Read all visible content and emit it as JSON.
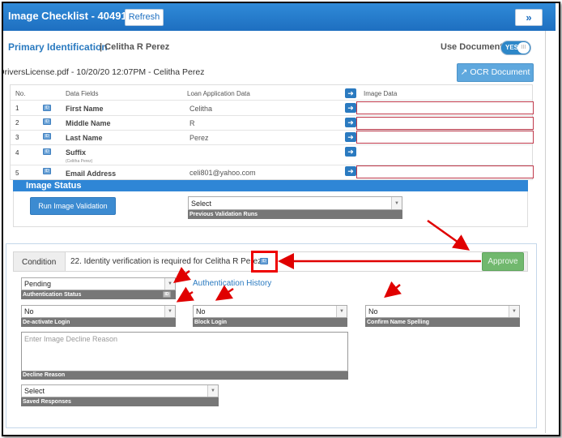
{
  "header": {
    "title": "Image Checklist - 404917",
    "refresh_label": "Refresh",
    "expand_symbol": "»"
  },
  "primary": {
    "title": "Primary Identification",
    "separator_name": "| Celitha R Perez",
    "use_document_label": "Use Document",
    "toggle_label": "YES",
    "toggle_knob": "III",
    "file_line": "DriversLicense.pdf - 10/20/20 12:07PM - Celitha Perez",
    "ocr_label": "OCR Document"
  },
  "table": {
    "headers": {
      "no": "No.",
      "fields": "Data Fields",
      "loan": "Loan Application Data",
      "image": "Image Data"
    },
    "rows": [
      {
        "no": "1",
        "field": "First Name",
        "loan": "Celitha",
        "note": ""
      },
      {
        "no": "2",
        "field": "Middle Name",
        "loan": "R",
        "note": ""
      },
      {
        "no": "3",
        "field": "Last Name",
        "loan": "Perez",
        "note": ""
      },
      {
        "no": "4",
        "field": "Suffix",
        "loan": "",
        "note": "(Celitha Perez)"
      },
      {
        "no": "5",
        "field": "Email Address",
        "loan": "celi801@yahoo.com",
        "note": ""
      }
    ]
  },
  "image_status": {
    "title": "Image Status",
    "run_label": "Run Image Validation",
    "previous_value": "Select",
    "previous_label": "Previous Validation Runs"
  },
  "condition": {
    "label": "Condition",
    "text": "22. Identity verification is required for Celitha R Perez",
    "approve_label": "Approve"
  },
  "form": {
    "auth_status_value": "Pending",
    "auth_status_label": "Authentication Status",
    "auth_history": "Authentication History",
    "deactivate_value": "No",
    "deactivate_label": "De-activate Login",
    "block_value": "No",
    "block_label": "Block Login",
    "confirm_value": "No",
    "confirm_label": "Confirm Name Spelling",
    "decline_placeholder": "Enter Image Decline Reason",
    "decline_label": "Decline Reason",
    "saved_value": "Select",
    "saved_label": "Saved Responses"
  },
  "colors": {
    "header_blue": "#1e6fc0",
    "accent_blue": "#2a7ac0",
    "approve_green": "#71b86e",
    "annotation_red": "#e00000"
  },
  "icons": {
    "id_card": "id-card-icon",
    "arrow": "arrow-right-icon",
    "ocr": "external-link-icon"
  }
}
